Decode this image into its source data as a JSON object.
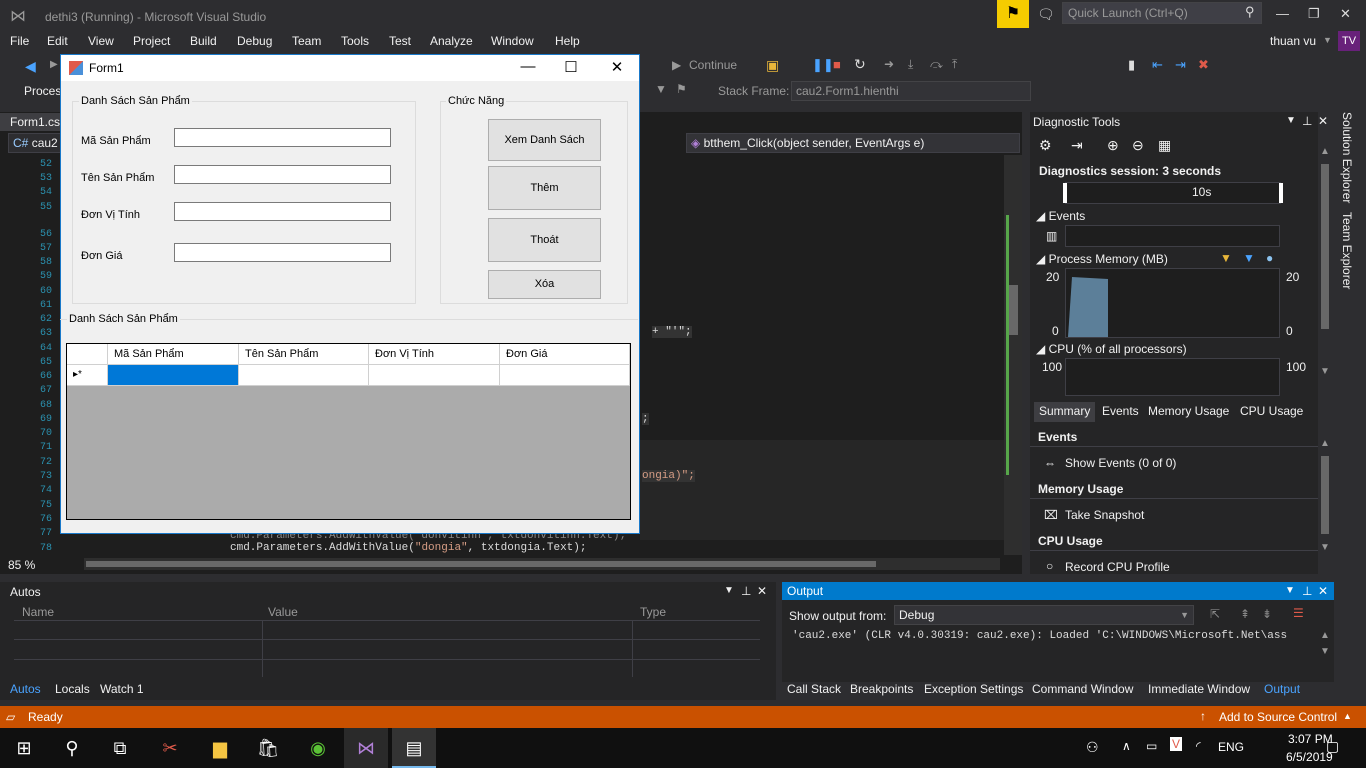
{
  "vs": {
    "title": "dethi3 (Running) - Microsoft Visual Studio",
    "quick_launch_placeholder": "Quick Launch (Ctrl+Q)",
    "menu": [
      "File",
      "Edit",
      "View",
      "Project",
      "Build",
      "Debug",
      "Team",
      "Tools",
      "Test",
      "Analyze",
      "Window",
      "Help"
    ],
    "user": "thuan vu",
    "avatar": "TV",
    "continue_label": "Continue",
    "process_label": "Proces",
    "stack_frame_label": "Stack Frame:",
    "stack_frame_value": "cau2.Form1.hienthi",
    "doc_tab": "Form1.cs",
    "nav_left": "cau2",
    "nav_right": "btthem_Click(object sender, EventArgs e)",
    "zoom": "85 %"
  },
  "editor": {
    "line_numbers": [
      "52",
      "53",
      "54",
      "55",
      "56",
      "57",
      "58",
      "59",
      "60",
      "61",
      "62",
      "63",
      "64",
      "65",
      "66",
      "67",
      "68",
      "69",
      "70",
      "71",
      "72",
      "73",
      "74",
      "75",
      "76",
      "77",
      "78"
    ],
    "fragments": {
      "f1": "+ \"'\";",
      "f2": ";",
      "f3": "ongia)\";",
      "line77": "cmd.Parameters.AddWithValue(\"donvitinh\", txtdonvitinh.Text);",
      "line78_pre": "cmd.Parameters.AddWithValue(",
      "line78_str": "\"dongia\"",
      "line78_post": ", txtdongia.Text);"
    }
  },
  "form": {
    "title": "Form1",
    "group_products": "Danh Sách Sản Phẩm",
    "group_functions": "Chức Năng",
    "labels": {
      "code": "Mã Sản Phẩm",
      "name": "Tên Sản Phẩm",
      "unit": "Đơn Vị Tính",
      "price": "Đơn Giá"
    },
    "buttons": {
      "view": "Xem Danh Sách",
      "add": "Thêm",
      "exit": "Thoát",
      "delete": "Xóa"
    },
    "list_label": "Danh Sách Sản Phẩm",
    "grid_columns": [
      "Mã Sản Phẩm",
      "Tên Sản Phẩm",
      "Đơn Vị Tính",
      "Đơn Giá"
    ],
    "new_row_marker": "▸*"
  },
  "diagnostics": {
    "title": "Diagnostic Tools",
    "session": "Diagnostics session: 3 seconds",
    "timeline_label": "10s",
    "events": "Events",
    "process_memory": "Process Memory (MB)",
    "mem_max": "20",
    "mem_min": "0",
    "cpu": "CPU (% of all processors)",
    "cpu_max": "100",
    "tabs": [
      "Summary",
      "Events",
      "Memory Usage",
      "CPU Usage"
    ],
    "sum_events": "Events",
    "show_events": "Show Events (0 of 0)",
    "sum_memory": "Memory Usage",
    "take_snapshot": "Take Snapshot",
    "sum_cpu": "CPU Usage",
    "record_cpu": "Record CPU Profile"
  },
  "side_tabs": [
    "Solution Explorer",
    "Team Explorer"
  ],
  "autos": {
    "title": "Autos",
    "columns": [
      "Name",
      "Value",
      "Type"
    ],
    "tabs": [
      "Autos",
      "Locals",
      "Watch 1"
    ]
  },
  "output": {
    "title": "Output",
    "show_from_label": "Show output from:",
    "show_from_value": "Debug",
    "line1": "'cau2.exe' (CLR v4.0.30319: cau2.exe): Loaded 'C:\\WINDOWS\\Microsoft.Net\\ass",
    "tabs": [
      "Call Stack",
      "Breakpoints",
      "Exception Settings",
      "Command Window",
      "Immediate Window",
      "Output"
    ]
  },
  "status": {
    "ready": "Ready",
    "source_control": "Add to Source Control"
  },
  "taskbar": {
    "lang": "ENG",
    "time": "3:07 PM",
    "date": "6/5/2019"
  },
  "colors": {
    "accent": "#007acc",
    "status_bar": "#ca5100",
    "selection": "#0078d7"
  }
}
